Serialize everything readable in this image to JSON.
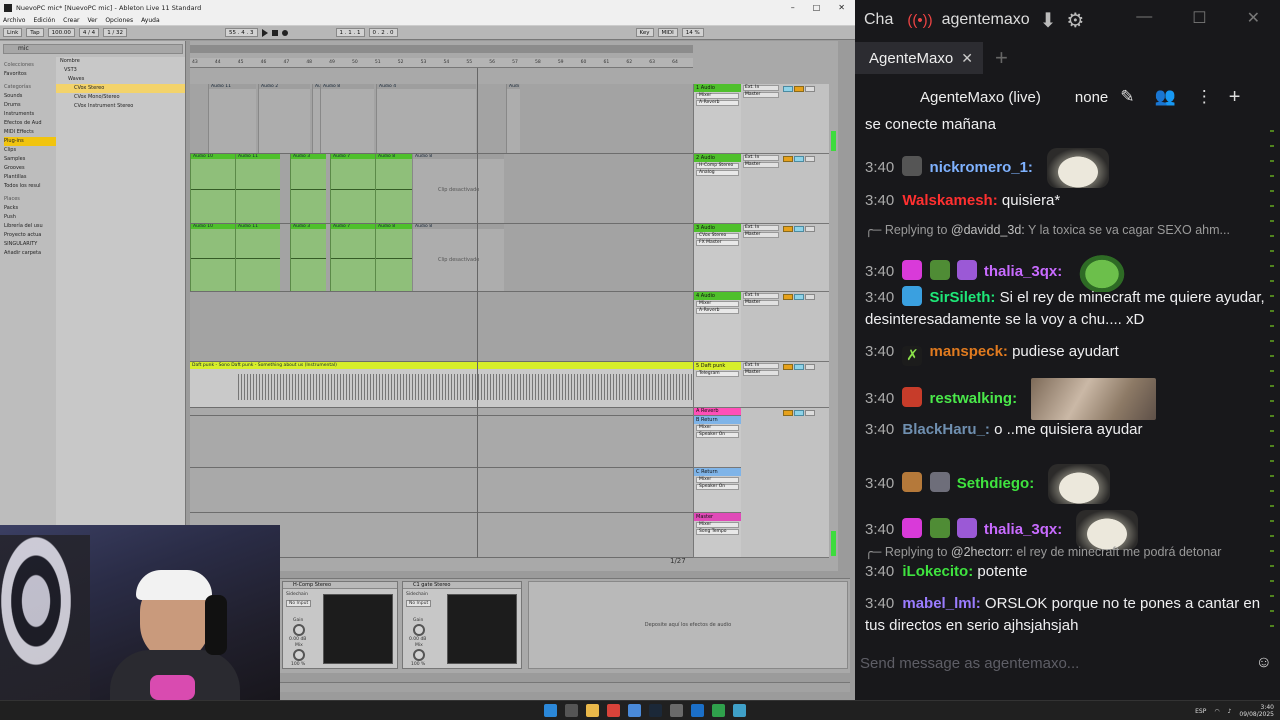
{
  "ableton": {
    "title": "NuevoPC mic* [NuevoPC mic] - Ableton Live 11 Standard",
    "menu": [
      "Archivo",
      "Edición",
      "Crear",
      "Ver",
      "Opciones",
      "Ayuda"
    ],
    "transport": {
      "link": "Link",
      "tap": "Tap",
      "tempo": "100.00",
      "signature": "4 / 4",
      "quantize": "1 / 32",
      "position": "55 . 4 . 3",
      "loop_start": "1 . 1 . 1",
      "loop_len": "0 . 2 . 0",
      "key": "Key",
      "midi": "MIDI",
      "cpu": "14 %"
    },
    "browser": {
      "search": "mic",
      "collections_label": "Colecciones",
      "favorites": "Favoritos",
      "categories_label": "Categorías",
      "categories": [
        "Sounds",
        "Drums",
        "Instruments",
        "Efectos de Aud",
        "MIDI Effects",
        "Plug-ins",
        "Clips",
        "Samples",
        "Grooves",
        "Plantillas",
        "Todos los resul"
      ],
      "selected_category": "Plug-ins",
      "places_label": "Places",
      "places": [
        "Packs",
        "Push",
        "Librería del usu",
        "Proyecto actua",
        "SINGULARITY",
        "Añadir carpeta"
      ],
      "column_header": "Nombre",
      "items": [
        "VST3",
        "Waves",
        "CVox Stereo",
        "CVox Mono/Stereo",
        "CVox Instrument Stereo"
      ],
      "selected_item": "CVox Stereo"
    },
    "ruler": [
      "43",
      "44",
      "45",
      "46",
      "47",
      "48",
      "49",
      "50",
      "51",
      "52",
      "53",
      "54",
      "55",
      "56",
      "57",
      "58",
      "59",
      "60",
      "61",
      "62",
      "63",
      "64"
    ],
    "tracks": [
      {
        "name": "1 Audio",
        "input": "Ext. In",
        "monitor": "Master",
        "devices": [
          "Mixer",
          "A-Reverb"
        ],
        "clips": [
          "Audio 11",
          "Audio 2",
          "Au",
          "Audio 8",
          "Audio 4",
          "Audi"
        ]
      },
      {
        "name": "2 Audio",
        "input": "Ext. In",
        "monitor": "Master",
        "devices": [
          "H-Comp Stereo",
          "Analog"
        ],
        "clips": [
          "Audio 10",
          "Audio 11",
          "Audio 3",
          "Audio 7",
          "Audio 8",
          "Audio 8"
        ],
        "disabled_label": "Clip desactivado"
      },
      {
        "name": "3 Audio",
        "input": "Ext. In",
        "monitor": "Master",
        "devices": [
          "CVox Stereo",
          "FX Master"
        ],
        "clips": [
          "Audio 10",
          "Audio 11",
          "Audio 3",
          "Audio 7",
          "Audio 8",
          "Audio 8"
        ],
        "disabled_label": "Clip desactivado"
      },
      {
        "name": "4 Audio",
        "input": "Ext. In",
        "monitor": "Master",
        "devices": [
          "Mixer",
          "A-Reverb"
        ],
        "clips": []
      },
      {
        "name": "5 Daft punk",
        "input": "Ext. In",
        "monitor": "Master",
        "devices": [
          "Telegram"
        ],
        "clips": [
          "Daft punk - Sono Daft punk - Something about us (Instrumental)"
        ]
      }
    ],
    "returns": [
      {
        "name": "A Reverb",
        "devices": []
      },
      {
        "name": "B Return",
        "devices": [
          "Mixer",
          "Speaker On"
        ]
      },
      {
        "name": "C Return",
        "devices": [
          "Mixer",
          "Speaker On"
        ]
      },
      {
        "name": "Master",
        "devices": [
          "Mixer",
          "Song Tempo"
        ]
      }
    ],
    "page_indicator": "1/27",
    "device_chain": [
      {
        "name": "H-Comp Stereo",
        "sidechain": "Sidechain",
        "input": "No Input",
        "gain": "Gain",
        "gain_val": "0.00 dB",
        "mix": "Mix",
        "mix_val": "100 %"
      },
      {
        "name": "C1 gate Stereo",
        "sidechain": "Sidechain",
        "input": "No Input",
        "gain": "Gain",
        "gain_val": "0.00 dB",
        "mix": "Mix",
        "mix_val": "100 %"
      }
    ],
    "drop_hint": "Deposite aquí los efectos de audio"
  },
  "chat": {
    "app_label": "Cha",
    "channel_user": "agentemaxo",
    "tab": "AgenteMaxo",
    "channel_title": "AgenteMaxo (live)",
    "mode": "none",
    "input_placeholder": "Send message as agentemaxo...",
    "messages": [
      {
        "ts": "",
        "user": "",
        "color": "#efeff1",
        "text": "se conecte mañana"
      },
      {
        "ts": "3:40",
        "user": "nickromero_1:",
        "color": "#7fb2ff",
        "text": ""
      },
      {
        "ts": "3:40",
        "user": "Walskamesh:",
        "color": "#ff3030",
        "text": "quisiera*"
      },
      {
        "reply_to": "@davidd_3d:",
        "reply_text": "Y la toxica se va cagar SEXO ahm...",
        "reply_prefix": "Replying to"
      },
      {
        "ts": "3:40",
        "user": "thalia_3qx:",
        "color": "#c86bff",
        "text": ""
      },
      {
        "ts": "3:40",
        "user": "SirSileth:",
        "color": "#1ee878",
        "text": "Si el rey de minecraft me quiere ayudar, desinteresadamente se la voy a chu.... xD"
      },
      {
        "ts": "3:40",
        "user": "manspeck:",
        "color": "#e07a1f",
        "text": "pudiese ayudart"
      },
      {
        "ts": "3:40",
        "user": "restwalking:",
        "color": "#4ae84a",
        "text": ""
      },
      {
        "ts": "3:40",
        "user": "BlackHaru_:",
        "color": "#6f8fb0",
        "text": "o ..me quisiera ayudar"
      },
      {
        "ts": "3:40",
        "user": "Sethdiego:",
        "color": "#3fe33f",
        "text": ""
      },
      {
        "ts": "3:40",
        "user": "thalia_3qx:",
        "color": "#c86bff",
        "text": ""
      },
      {
        "reply_to": "@2hectorr:",
        "reply_text": "el rey de minecraft me podrá detonar",
        "reply_prefix": "Replying to"
      },
      {
        "ts": "3:40",
        "user": "iLokecito:",
        "color": "#3fe33f",
        "text": "potente"
      },
      {
        "ts": "3:40",
        "user": "mabel_lml:",
        "color": "#9a7cff",
        "text": "ORSLOK porque no te pones a cantar en tus directos en serio ajhsjahsjah"
      }
    ]
  },
  "taskbar": {
    "language": "ESP",
    "time": "3:40",
    "date": "09/08/2025"
  },
  "colors": {
    "clip_green": "#8fbf7a",
    "clip_header": "#4fc02c",
    "yellow_track": "#d7ee2b",
    "chat_bg": "#18181b",
    "arm_orange": "#e6a11b"
  }
}
